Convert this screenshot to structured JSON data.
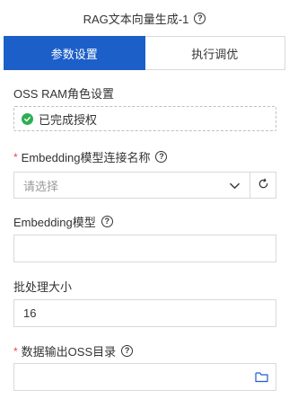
{
  "header": {
    "title": "RAG文本向量生成-1"
  },
  "tabs": [
    {
      "label": "参数设置",
      "active": true
    },
    {
      "label": "执行调优",
      "active": false
    }
  ],
  "form": {
    "oss_ram": {
      "label": "OSS RAM角色设置",
      "status_text": "已完成授权"
    },
    "embedding_conn": {
      "label": "Embedding模型连接名称",
      "required": true,
      "placeholder": "请选择"
    },
    "embedding_model": {
      "label": "Embedding模型",
      "value": ""
    },
    "batch_size": {
      "label": "批处理大小",
      "value": "16"
    },
    "output_dir": {
      "label": "数据输出OSS目录",
      "required": true,
      "value": ""
    }
  },
  "icons": {
    "help": "question-circle-icon",
    "check": "check-circle-icon",
    "chevron": "chevron-down-icon",
    "refresh": "refresh-icon",
    "folder": "folder-icon"
  },
  "colors": {
    "accent": "#1c5fc9",
    "success": "#2fae54",
    "required": "#e84a4a",
    "border": "#d9d9d9"
  }
}
